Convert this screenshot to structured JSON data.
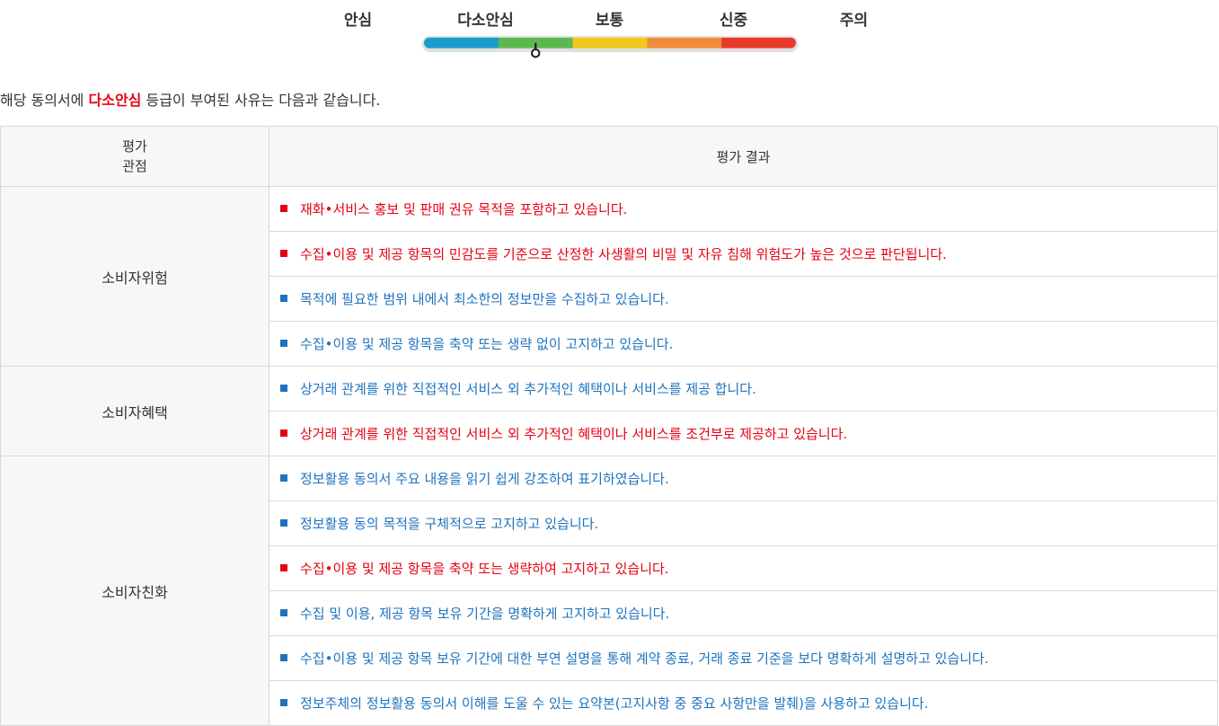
{
  "gauge": {
    "levels": [
      {
        "label": "안심",
        "color": "#1a9ccc"
      },
      {
        "label": "다소안심",
        "color": "#5db94f"
      },
      {
        "label": "보통",
        "color": "#f2c71e"
      },
      {
        "label": "신중",
        "color": "#f28c3a"
      },
      {
        "label": "주의",
        "color": "#e8392a"
      }
    ],
    "selected_index": 1,
    "pointer_icon": "pin-pointer-icon"
  },
  "intro": {
    "prefix": "해당 동의서에 ",
    "grade": "다소안심",
    "suffix": " 등급이 부여된 사유는 다음과 같습니다."
  },
  "table": {
    "header_category_line1": "평가",
    "header_category_line2": "관점",
    "header_result": "평가 결과",
    "groups": [
      {
        "category": "소비자위험",
        "items": [
          {
            "text": "재화•서비스 홍보 및 판매 권유 목적을 포함하고 있습니다.",
            "status": "negative"
          },
          {
            "text": "수집•이용 및 제공 항목의 민감도를 기준으로 산정한 사생활의 비밀 및 자유 침해 위험도가 높은 것으로 판단됩니다.",
            "status": "negative"
          },
          {
            "text": "목적에 필요한 범위 내에서 최소한의 정보만을 수집하고 있습니다.",
            "status": "positive"
          },
          {
            "text": "수집•이용 및 제공 항목을 축약 또는 생략 없이 고지하고 있습니다.",
            "status": "positive"
          }
        ]
      },
      {
        "category": "소비자혜택",
        "items": [
          {
            "text": "상거래 관계를 위한 직접적인 서비스 외 추가적인 혜택이나 서비스를 제공 합니다.",
            "status": "positive"
          },
          {
            "text": "상거래 관계를 위한 직접적인 서비스 외 추가적인 혜택이나 서비스를 조건부로 제공하고 있습니다.",
            "status": "negative"
          }
        ]
      },
      {
        "category": "소비자친화",
        "items": [
          {
            "text": "정보활용 동의서 주요 내용을 읽기 쉽게 강조하여 표기하였습니다.",
            "status": "positive"
          },
          {
            "text": "정보활용 동의 목적을 구체적으로 고지하고 있습니다.",
            "status": "positive"
          },
          {
            "text": "수집•이용 및 제공 항목을 축약 또는 생략하여 고지하고 있습니다.",
            "status": "negative"
          },
          {
            "text": "수집 및 이용, 제공 항목 보유 기간을 명확하게 고지하고 있습니다.",
            "status": "positive"
          },
          {
            "text": "수집•이용 및 제공 항목 보유 기간에 대한 부연 설명을 통해 계약 종료, 거래 종료 기준을 보다 명확하게 설명하고 있습니다.",
            "status": "positive"
          },
          {
            "text": "정보주체의 정보활용 동의서 이해를 도울 수 있는 요약본(고지사항 중 중요 사항만을 발췌)을 사용하고 있습니다.",
            "status": "positive"
          }
        ]
      }
    ]
  },
  "colors": {
    "negative": "#e60012",
    "positive": "#1e73be"
  }
}
